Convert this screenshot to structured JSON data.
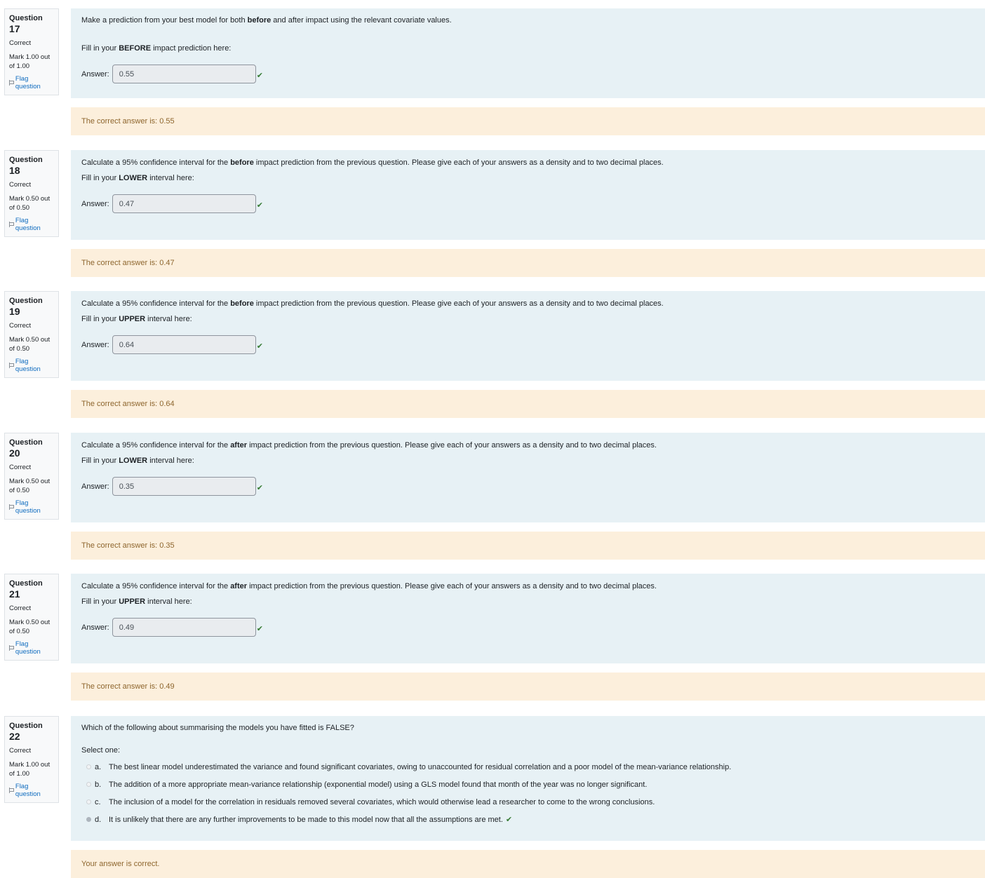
{
  "common": {
    "state": "Correct",
    "flag_label": "Flag question",
    "answer_label": "Answer:",
    "question_prefix": "Question"
  },
  "questions": [
    {
      "number": "17",
      "grade": "Mark 1.00 out of 1.00",
      "text_html": "Make a prediction from your best model for both <b>before</b> and after impact using the relevant covariate values.",
      "fill_html": "Fill in your <b>BEFORE</b> impact prediction here:",
      "answer": "0.55",
      "feedback": "The correct answer is: 0.55"
    },
    {
      "number": "18",
      "grade": "Mark 0.50 out of 0.50",
      "text_html": "Calculate a 95% confidence interval for the <b>before</b> impact prediction from the previous question. Please give each of your answers as a density and to two decimal places.",
      "fill_html": "Fill in your <b>LOWER</b> interval here:",
      "answer": "0.47",
      "feedback": "The correct answer is: 0.47"
    },
    {
      "number": "19",
      "grade": "Mark 0.50 out of 0.50",
      "text_html": "Calculate a 95% confidence interval for the <b>before</b> impact prediction from the previous question. Please give each of your answers as a density and to two decimal places.",
      "fill_html": "Fill in your <b>UPPER</b> interval here:",
      "answer": "0.64",
      "feedback": "The correct answer is: 0.64"
    },
    {
      "number": "20",
      "grade": "Mark 0.50 out of 0.50",
      "text_html": "Calculate a 95% confidence interval for the <b>after</b> impact prediction from the previous question. Please give each of your answers as a density and to two decimal places.",
      "fill_html": "Fill in your <b>LOWER</b> interval here:",
      "answer": "0.35",
      "feedback": "The correct answer is: 0.35"
    },
    {
      "number": "21",
      "grade": "Mark 0.50 out of 0.50",
      "text_html": "Calculate a 95% confidence interval for the <b>after</b> impact prediction from the previous question. Please give each of your answers as a density and to two decimal places.",
      "fill_html": "Fill in your <b>UPPER</b> interval here:",
      "answer": "0.49",
      "feedback": "The correct answer is: 0.49"
    }
  ],
  "mcq": {
    "number": "22",
    "grade": "Mark 1.00 out of 1.00",
    "text": "Which of the following about summarising the models you have fitted is FALSE?",
    "prompt": "Select one:",
    "options": [
      {
        "letter": "a.",
        "text": "The best linear model underestimated the variance and found significant covariates, owing to unaccounted for residual correlation and a poor model of the mean-variance relationship.",
        "selected": false
      },
      {
        "letter": "b.",
        "text": "The addition of a more appropriate mean-variance relationship (exponential model) using a GLS model found that month of the year was no longer significant.",
        "selected": false
      },
      {
        "letter": "c.",
        "text": "The inclusion of a model for the correlation in residuals removed several covariates, which would otherwise lead a researcher to come to the wrong conclusions.",
        "selected": false
      },
      {
        "letter": "d.",
        "text": "It is unlikely that there are any further improvements to be made to this model now that all the assumptions are met.",
        "selected": true
      }
    ],
    "feedback": "Your answer is correct."
  },
  "colors": {
    "content_bg": "#e7f1f5",
    "feedback_bg": "#fcefdc",
    "feedback_text": "#8e662e",
    "link": "#0f6cbf",
    "correct": "#357a32"
  }
}
